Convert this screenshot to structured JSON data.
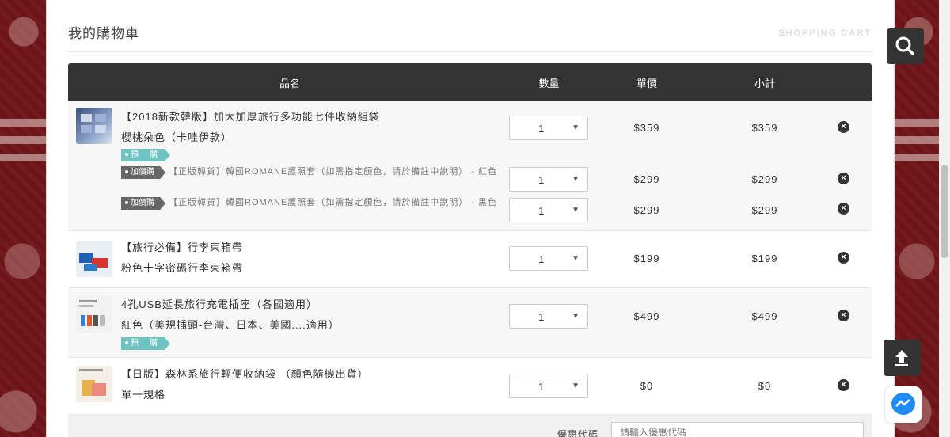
{
  "page": {
    "title": "我的購物車",
    "subtitle": "SHOPPING CART"
  },
  "table": {
    "headers": {
      "name": "品名",
      "qty": "數量",
      "unit_price": "單價",
      "subtotal": "小計"
    }
  },
  "items": [
    {
      "name": "【2018新款韓版】加大加厚旅行多功能七件收納組袋",
      "variant": "櫻桃朵色（卡哇伊款）",
      "tag": "預　購",
      "qty": "1",
      "unit_price": "$359",
      "subtotal": "$359",
      "addons": [
        {
          "tag": "加價購",
          "name": "【正版韓貨】韓國ROMANE護照套（如需指定顏色，請於備註中說明） - 紅色",
          "qty": "1",
          "unit_price": "$299",
          "subtotal": "$299"
        },
        {
          "tag": "加價購",
          "name": "【正版韓貨】韓國ROMANE護照套（如需指定顏色，請於備註中說明） - 黑色",
          "qty": "1",
          "unit_price": "$299",
          "subtotal": "$299"
        }
      ]
    },
    {
      "name": "【旅行必備】行李束箱帶",
      "variant": "粉色十字密碼行李束箱帶",
      "qty": "1",
      "unit_price": "$199",
      "subtotal": "$199"
    },
    {
      "name": "4孔USB延長旅行充電插座（各國適用）",
      "variant": "紅色（美規插頭-台灣、日本、美國....適用）",
      "tag": "預　購",
      "qty": "1",
      "unit_price": "$499",
      "subtotal": "$499"
    },
    {
      "name": "【日版】森林系旅行輕便收納袋 （顏色隨機出貨）",
      "variant": "單一規格",
      "qty": "1",
      "unit_price": "$0",
      "subtotal": "$0"
    }
  ],
  "coupon": {
    "label": "優惠代碼",
    "placeholder": "請輸入優惠代碼"
  },
  "icons": {
    "search": "search-icon",
    "remove": "close-circle-icon",
    "dropdown": "chevron-down-icon",
    "back_to_top": "arrow-up-icon",
    "messenger": "messenger-icon"
  },
  "colors": {
    "header_bg": "#333333",
    "preorder_tag": "#6fc3c3",
    "addon_tag": "#666666",
    "side_bg": "#6e1a1f"
  }
}
